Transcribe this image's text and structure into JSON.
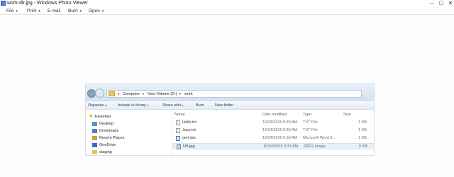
{
  "window": {
    "title": "work-dir.jpg - Windows Photo Viewer",
    "minimize_glyph": "–",
    "maximize_glyph": "▢",
    "close_glyph": "✕"
  },
  "menu": {
    "file": "File",
    "print": "Print",
    "email": "E-mail",
    "burn": "Burn",
    "open": "Open",
    "caret": "▾"
  },
  "explorer": {
    "breadcrumb": [
      "Computer",
      "New Volume (D:)",
      "work"
    ],
    "crumb_separator": "▸",
    "toolbar": {
      "organize": "Organize",
      "include": "Include in library",
      "share": "Share with",
      "burn": "Burn",
      "new_folder": "New folder",
      "caret": "▾"
    },
    "nav": {
      "favorites": "Favorites",
      "items": [
        "Desktop",
        "Downloads",
        "Recent Places",
        "OneDrive",
        "staging"
      ]
    },
    "columns": {
      "name": "Name",
      "date": "Date modified",
      "type": "Type",
      "size": "Size",
      "sort_glyph": "^"
    },
    "files": [
      {
        "name": "Hello.txt",
        "date": "10/24/2016 9:33 AM",
        "type": "TXT File",
        "size": "1 KB",
        "icon": "text-file-icon"
      },
      {
        "name": "Java.txt",
        "date": "10/24/2016 9:33 AM",
        "type": "TXT File",
        "size": "1 KB",
        "icon": "text-file-icon"
      },
      {
        "name": "perl.doc",
        "date": "10/24/2016 9:32 AM",
        "type": "Microsoft Word 9...",
        "size": "1 KB",
        "icon": "word-doc-icon"
      },
      {
        "name": "US.jpg",
        "date": "10/24/2016 9:33 AM",
        "type": "JPEG image",
        "size": "0 KB",
        "icon": "jpeg-image-icon"
      }
    ]
  },
  "colors": {
    "accent": "#4a8ad0",
    "folder": "#e8c65a",
    "selection": "#e8f0fb"
  }
}
